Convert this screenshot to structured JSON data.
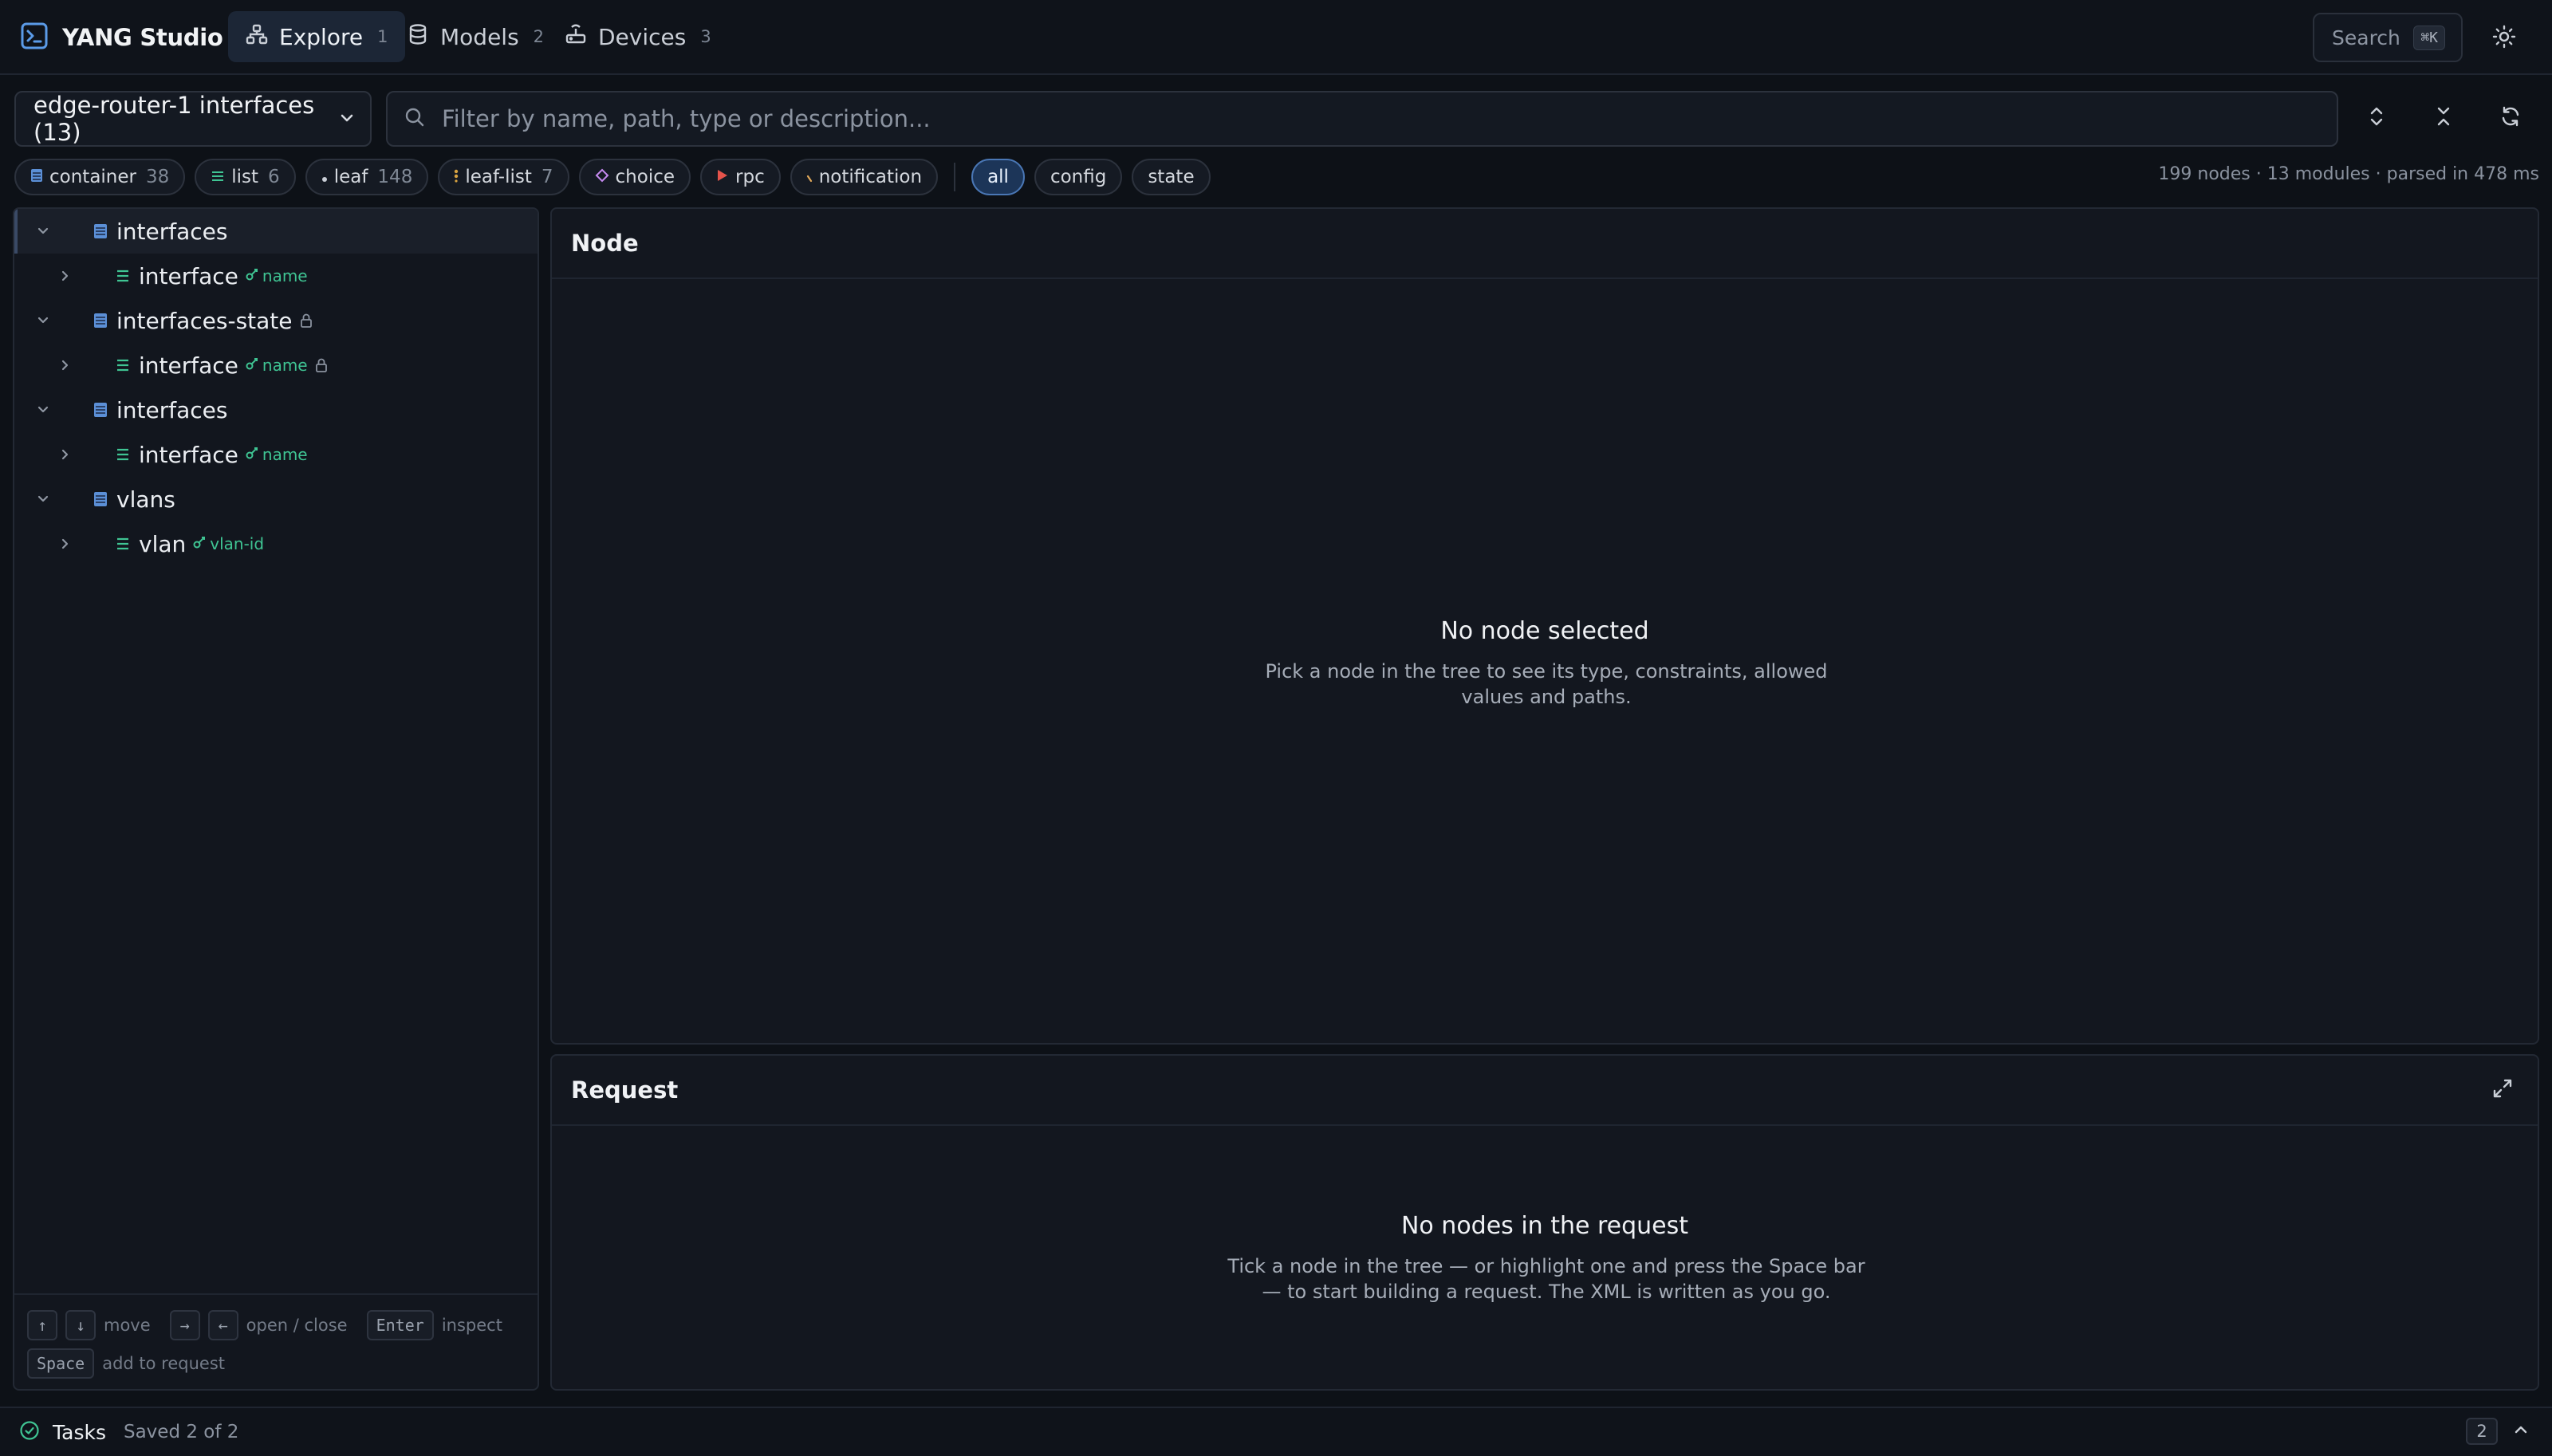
{
  "app": {
    "title": "YANG Studio"
  },
  "nav": {
    "tabs": [
      {
        "label": "Explore",
        "count": "1",
        "icon": "sitemap-icon"
      },
      {
        "label": "Models",
        "count": "2",
        "icon": "database-icon"
      },
      {
        "label": "Devices",
        "count": "3",
        "icon": "router-icon"
      }
    ],
    "active_tab": "Explore"
  },
  "header": {
    "search_label": "Search",
    "search_shortcut": "⌘K",
    "theme_icon": "sun-icon"
  },
  "toolbar": {
    "dataset_value": "edge-router-1 interfaces (13)",
    "filter_placeholder": "Filter by name, path, type or description...",
    "filter_value": "",
    "buttons": [
      "expand-all-icon",
      "collapse-all-icon",
      "refresh-icon"
    ]
  },
  "chips": {
    "types": [
      {
        "label": "container",
        "count": "38",
        "icon": "container-icon"
      },
      {
        "label": "list",
        "count": "6",
        "icon": "list-icon"
      },
      {
        "label": "leaf",
        "count": "148",
        "icon": "leaf-icon"
      },
      {
        "label": "leaf-list",
        "count": "7",
        "icon": "leaf-list-icon"
      },
      {
        "label": "choice",
        "count": "",
        "icon": "choice-icon"
      },
      {
        "label": "rpc",
        "count": "",
        "icon": "rpc-icon"
      },
      {
        "label": "notification",
        "count": "",
        "icon": "notification-icon"
      }
    ],
    "scopes": [
      {
        "label": "all",
        "selected": true
      },
      {
        "label": "config",
        "selected": false
      },
      {
        "label": "state",
        "selected": false
      }
    ]
  },
  "stats": "199 nodes · 13 modules · parsed in 478 ms",
  "tree": {
    "rows": [
      {
        "label": "interfaces",
        "kind": "container",
        "expanded": true,
        "key": "",
        "locked": false
      },
      {
        "label": "interface",
        "kind": "list",
        "expanded": false,
        "key": "name",
        "locked": false
      },
      {
        "label": "interfaces-state",
        "kind": "container",
        "expanded": true,
        "key": "",
        "locked": true
      },
      {
        "label": "interface",
        "kind": "list",
        "expanded": false,
        "key": "name",
        "locked": true
      },
      {
        "label": "interfaces",
        "kind": "container",
        "expanded": true,
        "key": "",
        "locked": false
      },
      {
        "label": "interface",
        "kind": "list",
        "expanded": false,
        "key": "name",
        "locked": false
      },
      {
        "label": "vlans",
        "kind": "container",
        "expanded": true,
        "key": "",
        "locked": false
      },
      {
        "label": "vlan",
        "kind": "list",
        "expanded": false,
        "key": "vlan-id",
        "locked": false
      }
    ],
    "shortcuts": {
      "up": "↑",
      "down": "↓",
      "move": "move",
      "right": "→",
      "left": "←",
      "open_close": "open / close",
      "enter": "Enter",
      "inspect": "inspect",
      "space": "Space",
      "add_to_request": "add to request"
    }
  },
  "node_panel": {
    "title": "Node",
    "empty_title": "No node selected",
    "empty_desc": "Pick a node in the tree to see its type, constraints, allowed values and paths."
  },
  "request_panel": {
    "title": "Request",
    "empty_title": "No nodes in the request",
    "empty_desc": "Tick a node in the tree — or highlight one and press the Space bar — to start building a request. The XML is written as you go."
  },
  "footer": {
    "tasks_label": "Tasks",
    "tasks_status": "Saved 2 of 2",
    "tasks_count": "2"
  },
  "colors": {
    "background": "#0d1117",
    "accent_blue": "#4a90e2",
    "key_green": "#3fc493",
    "list_green": "#3fc493",
    "container_blue": "#5b8fd6",
    "rpc_red": "#e5534b",
    "leaflist_orange": "#d9a441",
    "choice_purple": "#c58af0"
  }
}
